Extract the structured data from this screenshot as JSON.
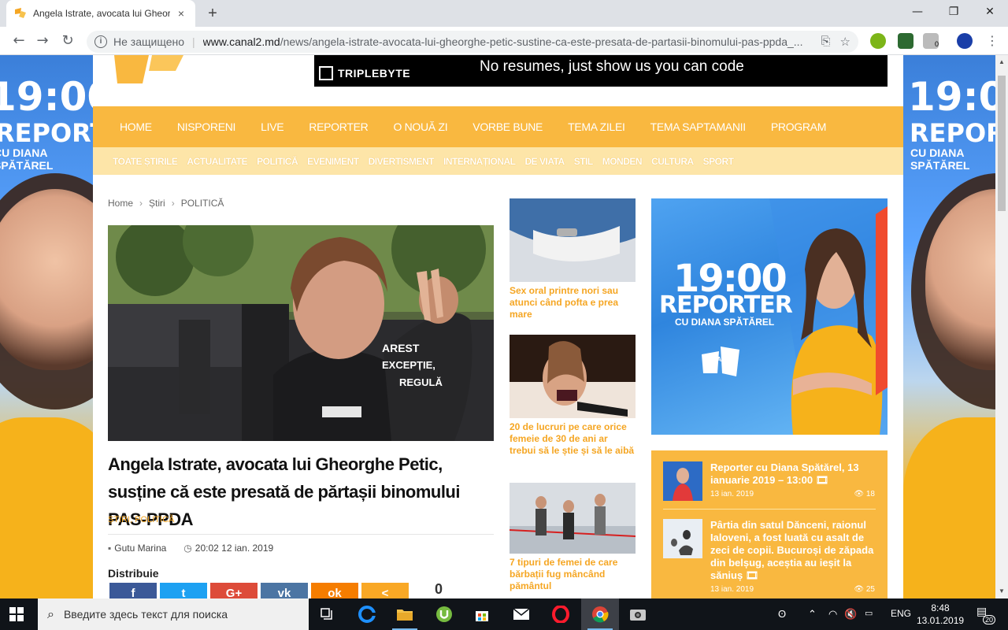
{
  "browser": {
    "tab_title": "Angela Istrate, avocata lui Gheorg",
    "tab_close": "×",
    "new_tab": "+",
    "win_min": "—",
    "win_restore": "❐",
    "win_close": "✕",
    "back": "←",
    "forward": "→",
    "reload": "↻",
    "security_label": "Не защищено",
    "url_host": "www.canal2.md",
    "url_path": "/news/angela-istrate-avocata-lui-gheorghe-petic-sustine-ca-este-presata-de-partasii-binomului-pas-ppda_...",
    "ext_badge": "0"
  },
  "header": {
    "banner_brand": "TRIPLEBYTE",
    "banner_text": "No resumes, just show us you can code"
  },
  "side_ads": {
    "time": "19:00",
    "title": "REPORTER",
    "host": "CU DIANA SPĂTĂREL"
  },
  "main_nav": [
    "HOME",
    "NISPORENI",
    "LIVE",
    "REPORTER",
    "O NOUĂ ZI",
    "VORBE BUNE",
    "TEMA ZILEI",
    "TEMA SAPTAMANII",
    "PROGRAM"
  ],
  "sub_nav": [
    "TOATE ȘTIRILE",
    "ACTUALITATE",
    "POLITICĂ",
    "EVENIMENT",
    "DIVERTISMENT",
    "INTERNAȚIONAL",
    "DE VIATA",
    "STIL",
    "MONDEN",
    "CULTURA",
    "SPORT"
  ],
  "breadcrumb": {
    "home": "Home",
    "section": "Știri",
    "category": "POLITICĂ",
    "sep": "›"
  },
  "article": {
    "photo_text_1": "AREST",
    "photo_text_2": "EXCEPȚIE,",
    "photo_text_3": "REGULĂ",
    "title": "Angela Istrate, avocata lui Gheorghe Petic, susține că este presată de părtașii binomului PAS-PPDA",
    "categories": "ȘTIRI, POLITICĂ",
    "author": "Gutu Marina",
    "datetime": "20:02 12 ian. 2019",
    "share_label": "Distribuie",
    "share_count": "0",
    "share_buttons": [
      "f",
      "t",
      "G+",
      "vk",
      "ok",
      "<"
    ]
  },
  "related": [
    {
      "caption": "Sex oral printre nori sau atunci când pofta e prea mare"
    },
    {
      "caption": "20 de lucruri pe care orice femeie de 30 de ani ar trebui să le știe și să le aibă"
    },
    {
      "caption": "7 tipuri de femei de care bărbații fug mâncând pământul"
    }
  ],
  "promo": {
    "time": "19:00",
    "title": "REPORTER",
    "host": "CU DIANA SPĂTĂREL",
    "logo": "CANAL 2"
  },
  "feed": [
    {
      "title": "Reporter cu Diana Spătărel, 13 ianuarie 2019 – 13:00 🎞",
      "date": "13 ian. 2019",
      "views": "18"
    },
    {
      "title": "Pârtia din satul Dănceni, raionul Ialoveni, a fost luată cu asalt de zeci de copii. Bucuroși de zăpada din belșug, aceștia au ieșit la săniuș 🎞",
      "date": "13 ian. 2019",
      "views": "25"
    }
  ],
  "taskbar": {
    "search_placeholder": "Введите здесь текст для поиска",
    "lang": "ENG",
    "time": "8:48",
    "date": "13.01.2019",
    "notif_count": "20"
  },
  "colors": {
    "brand_orange": "#f9b840",
    "sub_nav": "#fde5a8",
    "link_orange": "#f5a623"
  }
}
